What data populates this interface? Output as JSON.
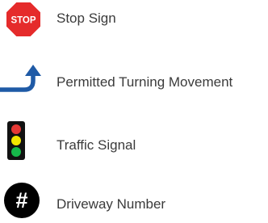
{
  "legend": {
    "items": [
      {
        "icon": "stop-sign-icon",
        "icon_text": "STOP",
        "label": "Stop Sign"
      },
      {
        "icon": "turn-arrow-icon",
        "label": "Permitted Turning Movement"
      },
      {
        "icon": "traffic-signal-icon",
        "label": "Traffic Signal"
      },
      {
        "icon": "driveway-number-icon",
        "icon_text": "#",
        "label": "Driveway Number"
      }
    ]
  },
  "colors": {
    "stop_red": "#e52b2b",
    "arrow_blue": "#1f5aa6",
    "signal_body": "#111111",
    "signal_red": "#e53935",
    "signal_yellow": "#f2e600",
    "signal_green": "#16b84a",
    "driveway_circle": "#000000",
    "label_text": "#3b3b3b"
  }
}
